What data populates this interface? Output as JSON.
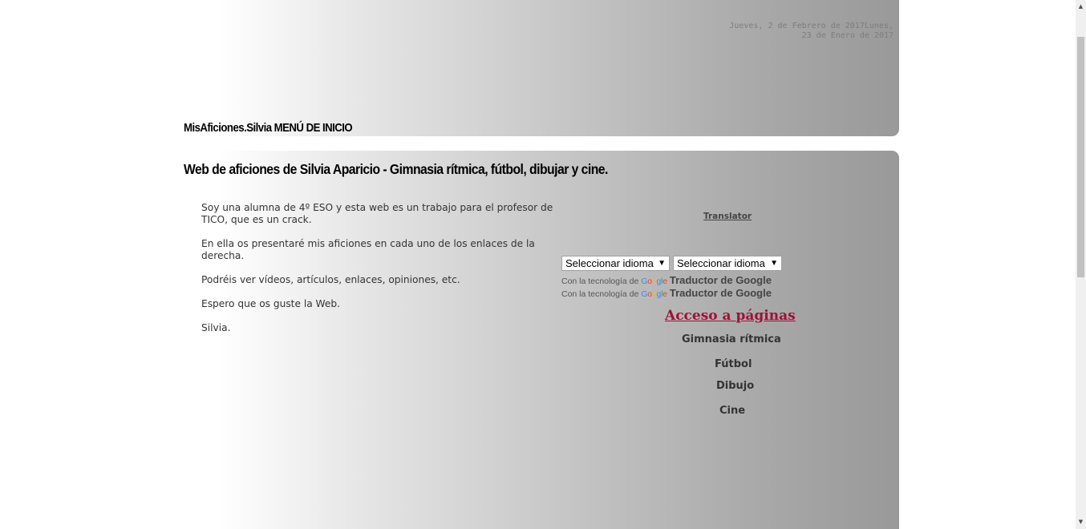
{
  "header": {
    "date_line1": "Jueves, 2 de Febrero de 2017Lunes,",
    "date_line2": "23 de Enero de 2017",
    "site_title": "MisAficiones.Silvia MENÚ DE INICIO"
  },
  "main": {
    "heading": "Web de aficiones de Silvia Aparicio - Gimnasia rítmica, fútbol, dibujar y cine.",
    "paragraphs": [
      "Soy una alumna de 4º ESO y esta web es un trabajo para el profesor de TICO, que es un crack.",
      "En ella os presentaré mis aficiones en cada uno de los enlaces de la derecha.",
      "Podréis ver vídeos, artículos, enlaces, opiniones, etc.",
      "Espero que os guste la Web.",
      "Silvia."
    ]
  },
  "translator": {
    "label": "Translator",
    "select_1": "Seleccionar idioma",
    "select_2": "Seleccionar idioma",
    "arrow": "▼",
    "powered_by": "Con la tecnología de",
    "google_logo": [
      "G",
      "o",
      "o",
      "g",
      "l",
      "e"
    ],
    "brand": "Traductor de Google"
  },
  "access": {
    "heading": "Acceso a páginas",
    "links": [
      "Gimnasia rítmica",
      "Fútbol",
      "Dibujo",
      "Cine"
    ]
  },
  "scrollbar": {
    "up_arrow": "▲",
    "down_arrow": "▼"
  },
  "colors": {
    "access_heading": "#9b1239",
    "gradient_end": "#999999"
  }
}
